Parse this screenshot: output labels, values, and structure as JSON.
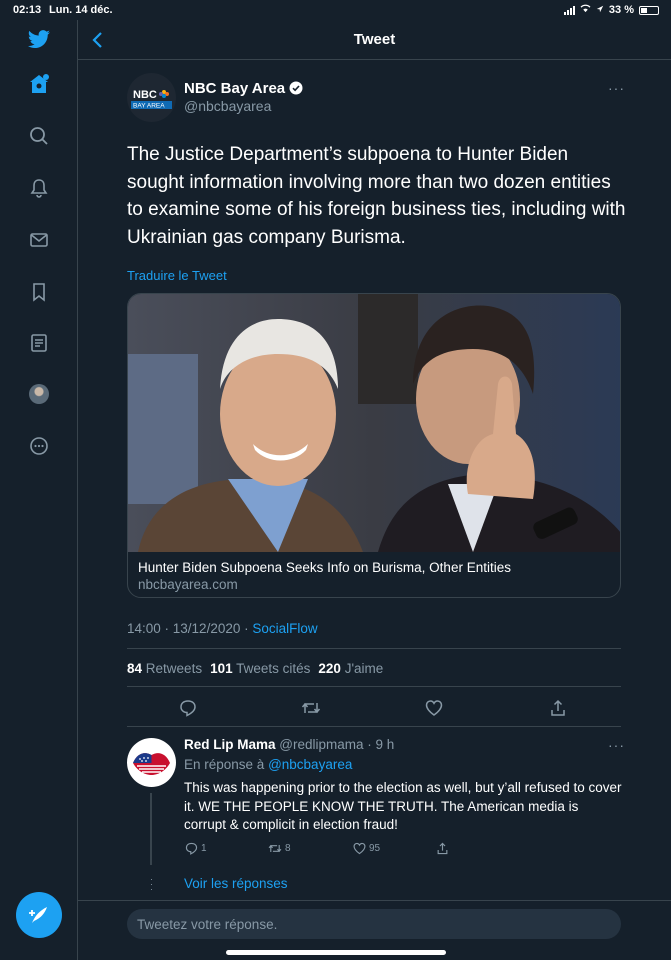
{
  "status_bar": {
    "time": "02:13",
    "date": "Lun. 14 déc.",
    "battery": "33 %"
  },
  "colors": {
    "accent": "#1da1f2",
    "background": "#15202b",
    "secondary_text": "#8899a6",
    "border": "#38444d"
  },
  "sidebar": {
    "items": [
      {
        "icon": "twitter-logo-icon"
      },
      {
        "icon": "home-icon"
      },
      {
        "icon": "explore-icon"
      },
      {
        "icon": "notifications-bell-icon"
      },
      {
        "icon": "messages-envelope-icon"
      },
      {
        "icon": "bookmark-icon"
      },
      {
        "icon": "lists-icon"
      },
      {
        "icon": "profile-avatar"
      },
      {
        "icon": "more-options-icon"
      }
    ],
    "compose_icon": "compose-tweet-icon"
  },
  "header": {
    "title": "Tweet"
  },
  "tweet": {
    "author_name": "NBC Bay Area",
    "author_handle": "@nbcbayarea",
    "avatar_text_top": "NBC",
    "avatar_text_bottom": "BAY AREA",
    "text": "The Justice Department’s subpoena to Hunter Biden sought information involving more than two dozen entities to examine some of his foreign business ties, including with Ukrainian gas company Burisma.",
    "translate_label": "Traduire le Tweet",
    "card": {
      "title": "Hunter Biden Subpoena Seeks Info on Burisma, Other Entities",
      "domain": "nbcbayarea.com"
    },
    "time": "14:00 · 13/12/2020 · ",
    "source": "SocialFlow",
    "stats": {
      "retweets_count": "84",
      "retweets_label": "Retweets",
      "quotes_count": "101",
      "quotes_label": "Tweets cités",
      "likes_count": "220",
      "likes_label": "J'aime"
    }
  },
  "reply": {
    "author_name": "Red Lip Mama",
    "author_meta": "@redlipmama · 9 h",
    "replying_to_label": "En réponse à",
    "replying_to_handle": "@nbcbayarea",
    "text": "This was happening prior to the election as well, but y’all refused to cover it. WE THE PEOPLE KNOW THE TRUTH. The American media is corrupt & complicit in election fraud!",
    "reply_count": "1",
    "retweet_count": "8",
    "like_count": "95",
    "see_replies": "Voir les réponses"
  },
  "composer": {
    "placeholder": "Tweetez votre réponse."
  }
}
